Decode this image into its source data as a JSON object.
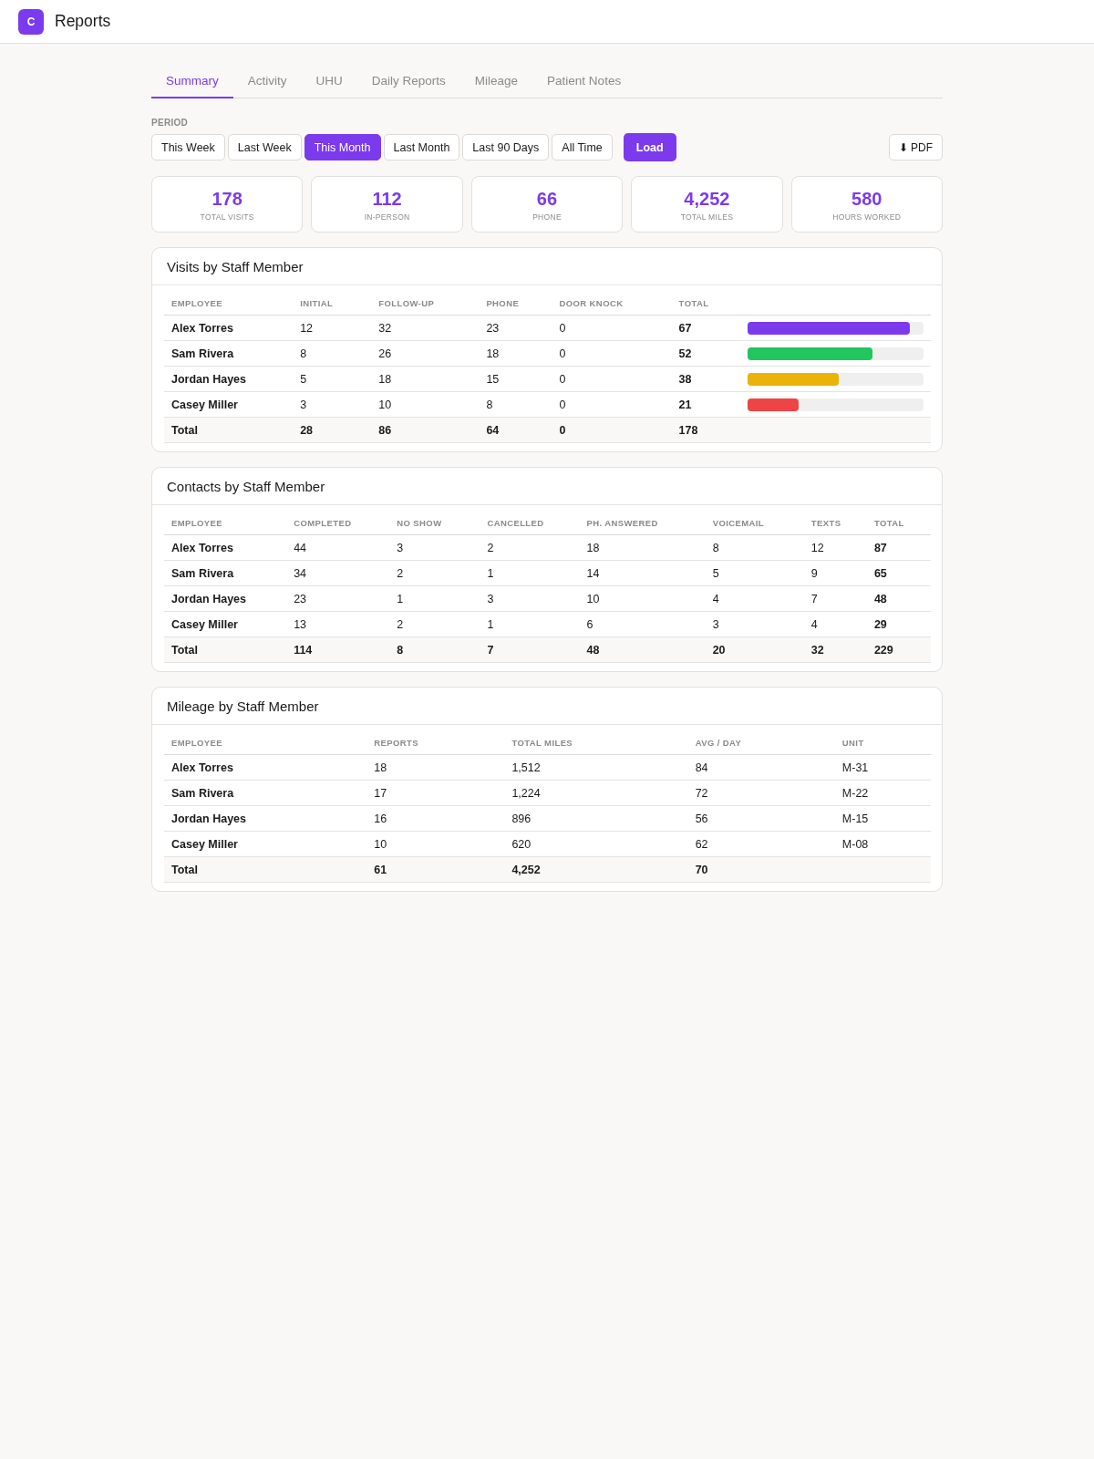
{
  "app": {
    "logo": "C",
    "title": "Reports"
  },
  "tabs": [
    {
      "label": "Summary",
      "selected": true
    },
    {
      "label": "Activity",
      "selected": false
    },
    {
      "label": "UHU",
      "selected": false
    },
    {
      "label": "Daily Reports",
      "selected": false
    },
    {
      "label": "Mileage",
      "selected": false
    },
    {
      "label": "Patient Notes",
      "selected": false
    }
  ],
  "period": {
    "label": "PERIOD",
    "options": [
      {
        "label": "This Week",
        "selected": false
      },
      {
        "label": "Last Week",
        "selected": false
      },
      {
        "label": "This Month",
        "selected": true
      },
      {
        "label": "Last Month",
        "selected": false
      },
      {
        "label": "Last 90 Days",
        "selected": false
      },
      {
        "label": "All Time",
        "selected": false
      }
    ],
    "load_button": "Load",
    "pdf_button": "⬇ PDF"
  },
  "stats": [
    {
      "value": "178",
      "label": "TOTAL VISITS"
    },
    {
      "value": "112",
      "label": "IN-PERSON"
    },
    {
      "value": "66",
      "label": "PHONE"
    },
    {
      "value": "4,252",
      "label": "TOTAL MILES"
    },
    {
      "value": "580",
      "label": "HOURS WORKED"
    }
  ],
  "panels": [
    {
      "title": "Visits by Staff Member",
      "columns": [
        {
          "label": "EMPLOYEE",
          "bold": true
        },
        {
          "label": "INITIAL",
          "bold": false
        },
        {
          "label": "FOLLOW-UP",
          "bold": false
        },
        {
          "label": "PHONE",
          "bold": false
        },
        {
          "label": "DOOR KNOCK",
          "bold": false
        },
        {
          "label": "TOTAL",
          "bold": true
        }
      ],
      "rows": [
        {
          "cells": [
            "Alex Torres",
            "12",
            "32",
            "23",
            "0",
            "67"
          ],
          "level": 0.92,
          "color": "#7c3aed"
        },
        {
          "cells": [
            "Sam Rivera",
            "8",
            "26",
            "18",
            "0",
            "52"
          ],
          "level": 0.71,
          "color": "#22c55e"
        },
        {
          "cells": [
            "Jordan Hayes",
            "5",
            "18",
            "15",
            "0",
            "38"
          ],
          "level": 0.52,
          "color": "#eab308"
        },
        {
          "cells": [
            "Casey Miller",
            "3",
            "10",
            "8",
            "0",
            "21"
          ],
          "level": 0.29,
          "color": "#ef4444"
        }
      ],
      "total_row": [
        "Total",
        "28",
        "86",
        "64",
        "0",
        "178"
      ]
    },
    {
      "title": "Contacts by Staff Member",
      "columns": [
        {
          "label": "EMPLOYEE",
          "bold": true
        },
        {
          "label": "COMPLETED",
          "bold": false
        },
        {
          "label": "NO SHOW",
          "bold": false
        },
        {
          "label": "CANCELLED",
          "bold": false
        },
        {
          "label": "PH. ANSWERED",
          "bold": false
        },
        {
          "label": "VOICEMAIL",
          "bold": false
        },
        {
          "label": "TEXTS",
          "bold": false
        },
        {
          "label": "TOTAL",
          "bold": true
        }
      ],
      "rows": [
        {
          "cells": [
            "Alex Torres",
            "44",
            "3",
            "2",
            "18",
            "8",
            "12",
            "87"
          ]
        },
        {
          "cells": [
            "Sam Rivera",
            "34",
            "2",
            "1",
            "14",
            "5",
            "9",
            "65"
          ]
        },
        {
          "cells": [
            "Jordan Hayes",
            "23",
            "1",
            "3",
            "10",
            "4",
            "7",
            "48"
          ]
        },
        {
          "cells": [
            "Casey Miller",
            "13",
            "2",
            "1",
            "6",
            "3",
            "4",
            "29"
          ]
        }
      ],
      "total_row": [
        "Total",
        "114",
        "8",
        "7",
        "48",
        "20",
        "32",
        "229"
      ]
    },
    {
      "title": "Mileage by Staff Member",
      "columns": [
        {
          "label": "EMPLOYEE",
          "bold": true
        },
        {
          "label": "REPORTS",
          "bold": false
        },
        {
          "label": "TOTAL MILES",
          "bold": false
        },
        {
          "label": "AVG / DAY",
          "bold": false
        },
        {
          "label": "UNIT",
          "bold": false
        }
      ],
      "rows": [
        {
          "cells": [
            "Alex Torres",
            "18",
            "1,512",
            "84",
            "M-31"
          ]
        },
        {
          "cells": [
            "Sam Rivera",
            "17",
            "1,224",
            "72",
            "M-22"
          ]
        },
        {
          "cells": [
            "Jordan Hayes",
            "16",
            "896",
            "56",
            "M-15"
          ]
        },
        {
          "cells": [
            "Casey Miller",
            "10",
            "620",
            "62",
            "M-08"
          ]
        }
      ],
      "total_row": [
        "Total",
        "61",
        "4,252",
        "70"
      ]
    }
  ]
}
